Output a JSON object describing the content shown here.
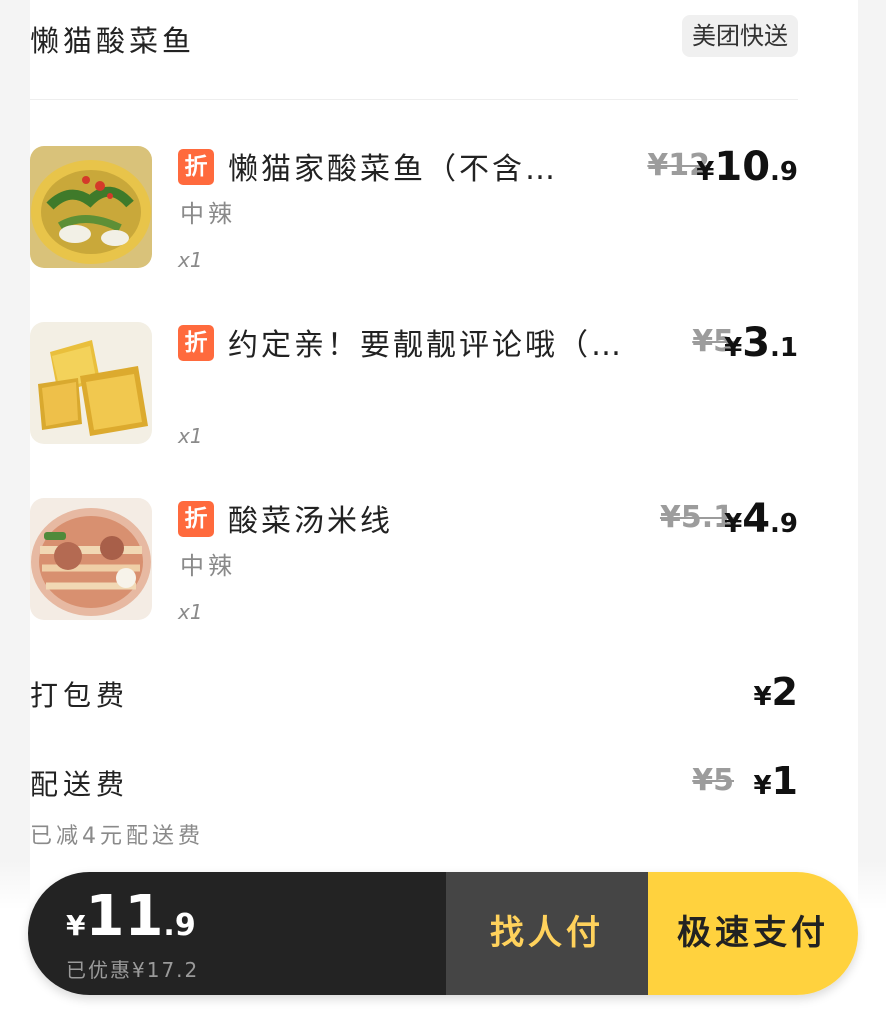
{
  "shop": {
    "name": "懒猫酸菜鱼",
    "delivery_badge": "美团快送"
  },
  "items": [
    {
      "discount_tag": "折",
      "name": "懒猫家酸菜鱼（不含…",
      "spec": "中辣",
      "qty": "x1",
      "orig_price": "¥12",
      "price_yen": "¥",
      "price_int": "10",
      "price_dec": ".9"
    },
    {
      "discount_tag": "折",
      "name": "约定亲！要靓靓评论哦（…",
      "spec": "",
      "qty": "x1",
      "orig_price": "¥5",
      "price_yen": "¥",
      "price_int": "3",
      "price_dec": ".1"
    },
    {
      "discount_tag": "折",
      "name": "酸菜汤米线",
      "spec": "中辣",
      "qty": "x1",
      "orig_price": "¥5.1",
      "price_yen": "¥",
      "price_int": "4",
      "price_dec": ".9"
    }
  ],
  "fees": {
    "packing": {
      "label": "打包费",
      "yen": "¥",
      "value": "2"
    },
    "delivery": {
      "label": "配送费",
      "orig": "¥5",
      "yen": "¥",
      "value": "1",
      "note": "已减4元配送费"
    }
  },
  "pay_bar": {
    "total_yen": "¥",
    "total_int": "11",
    "total_dec": ".9",
    "saved": "已优惠¥17.2",
    "find_pay_label": "找人付",
    "fast_pay_label": "极速支付"
  },
  "colors": {
    "discount_tag": "#ff6a3d",
    "pay_dark": "#232323",
    "find_pay_bg": "#454545",
    "find_pay_text": "#ffd25c",
    "fast_pay_bg": "#ffd23e"
  }
}
